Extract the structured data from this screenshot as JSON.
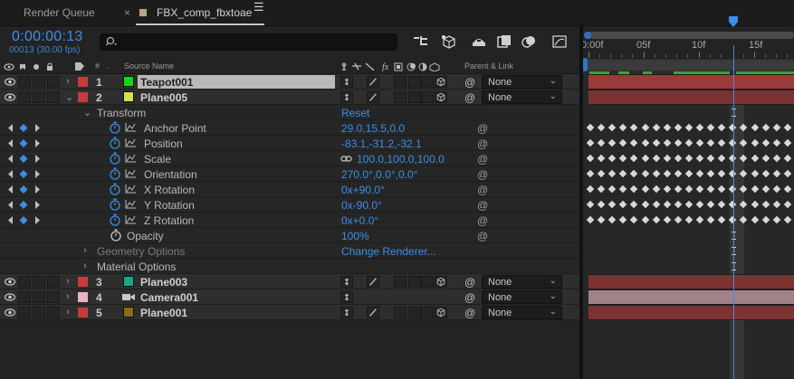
{
  "tabs": {
    "render_queue": "Render Queue",
    "close_glyph": "×",
    "comp": "FBX_comp_fbxtoae",
    "menu_glyph": "☰"
  },
  "header": {
    "timecode": "0:00:00:13",
    "frame_fps": "00013 (30.00 fps)",
    "search_placeholder": ""
  },
  "ruler": {
    "labels": [
      "0:00f",
      "05f",
      "10f",
      "15f"
    ]
  },
  "columns": {
    "hash": "#",
    "source_name": "Source Name",
    "parent_link": "Parent & Link"
  },
  "colors": {
    "accent_blue": "#3d8fe8",
    "teapot_label": "#c43c3c",
    "teapot_src": "#18d51c",
    "plane005_label": "#c43c3c",
    "plane005_src": "#d7e04f",
    "plane003_label": "#c43c3c",
    "plane003_src": "#1aa58c",
    "camera_label": "#e8b4c2",
    "plane001_label": "#c43c3c",
    "plane001_src": "#8a6a12"
  },
  "layers": [
    {
      "num": "1",
      "name": "Teapot001",
      "parent": "None"
    },
    {
      "num": "2",
      "name": "Plane005",
      "parent": "None"
    },
    {
      "num": "3",
      "name": "Plane003",
      "parent": "None"
    },
    {
      "num": "4",
      "name": "Camera001",
      "parent": "None"
    },
    {
      "num": "5",
      "name": "Plane001",
      "parent": "None"
    }
  ],
  "transform": {
    "label": "Transform",
    "reset": "Reset",
    "props": [
      {
        "name": "Anchor Point",
        "value": "29.0,15.5,0.0"
      },
      {
        "name": "Position",
        "value": "-83.1,-31.2,-32.1"
      },
      {
        "name": "Scale",
        "value": "100.0,100.0,100.0"
      },
      {
        "name": "Orientation",
        "value": "270.0°,0.0°,0.0°"
      },
      {
        "name": "X Rotation",
        "value": "0x+90.0°"
      },
      {
        "name": "Y Rotation",
        "value": "0x-90.0°"
      },
      {
        "name": "Z Rotation",
        "value": "0x+0.0°"
      },
      {
        "name": "Opacity",
        "value": "100%"
      }
    ]
  },
  "groups": {
    "geometry": "Geometry Options",
    "change_renderer": "Change Renderer...",
    "material": "Material Options"
  },
  "playhead": {
    "frame": 13
  }
}
